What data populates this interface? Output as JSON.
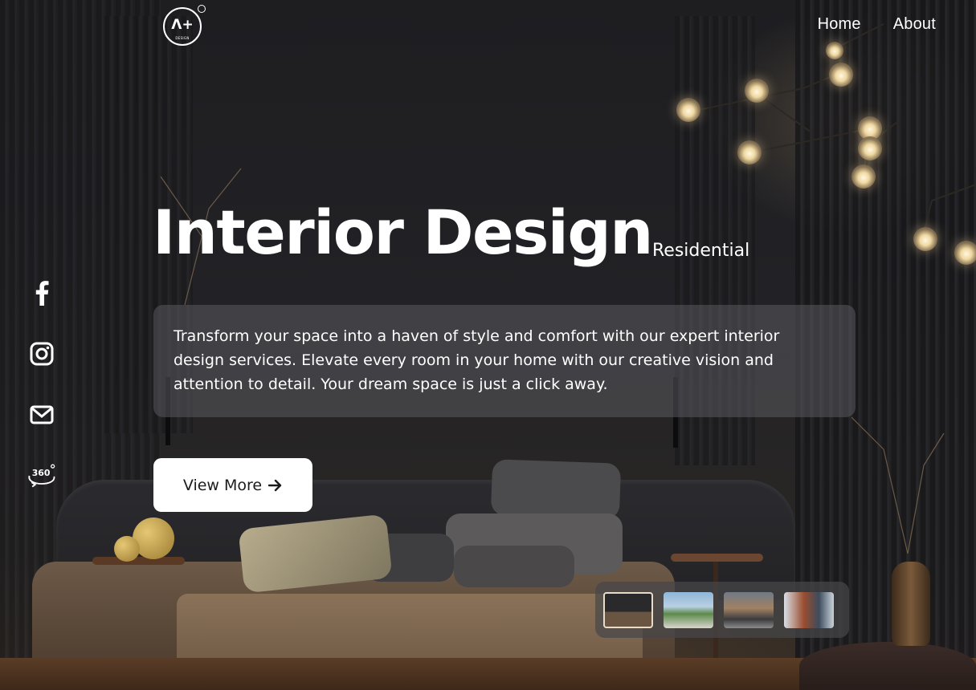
{
  "brand": {
    "logo_mark": "Λ+",
    "logo_word": "DESIGN"
  },
  "nav": {
    "items": [
      {
        "label": "Home"
      },
      {
        "label": "About"
      }
    ]
  },
  "social": {
    "items": [
      {
        "name": "facebook-icon"
      },
      {
        "name": "instagram-icon"
      },
      {
        "name": "mail-icon"
      },
      {
        "name": "tour-360-icon",
        "text": "360"
      }
    ]
  },
  "hero": {
    "title": "Interior Design",
    "subtitle": "Residential",
    "description": "Transform your space into a haven of style and comfort with our expert interior design services. Elevate every room in your home with our creative vision and attention to detail. Your dream space is just a click away.",
    "cta_label": "View More",
    "cta_icon": "arrow-right-icon"
  },
  "gallery": {
    "active_index": 0,
    "thumbnails": [
      {
        "name": "thumbnail-dark-bedroom"
      },
      {
        "name": "thumbnail-modern-house"
      },
      {
        "name": "thumbnail-restaurant-terrace"
      },
      {
        "name": "thumbnail-office-interior"
      }
    ]
  },
  "colors": {
    "text": "#ffffff",
    "button_bg": "#ffffff",
    "button_text": "#1c1c1c",
    "card_bg": "rgba(90,90,95,0.55)"
  }
}
